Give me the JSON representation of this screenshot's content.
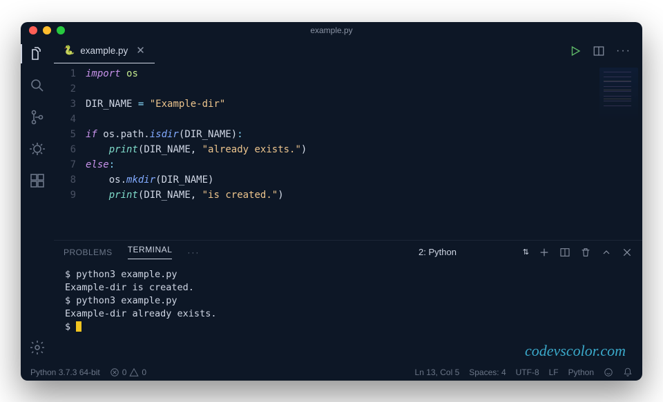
{
  "window": {
    "title": "example.py"
  },
  "tab": {
    "filename": "example.py",
    "lang_icon": "🐍"
  },
  "code": {
    "lines": [
      {
        "n": 1,
        "html": "<span class='tok-kw'>import</span> <span class='tok-mod'>os</span>"
      },
      {
        "n": 2,
        "html": ""
      },
      {
        "n": 3,
        "html": "<span class='tok-const'>DIR_NAME</span> <span class='tok-op'>=</span> <span class='tok-str'>\"Example-dir\"</span>"
      },
      {
        "n": 4,
        "html": ""
      },
      {
        "n": 5,
        "html": "<span class='tok-kw'>if</span> os.path.<span class='tok-fn'>isdir</span><span class='tok-punc'>(</span>DIR_NAME<span class='tok-punc'>)</span><span class='tok-op'>:</span>"
      },
      {
        "n": 6,
        "html": "    <span class='tok-builtin'>print</span><span class='tok-punc'>(</span>DIR_NAME<span class='tok-punc'>,</span> <span class='tok-str'>\"already exists.\"</span><span class='tok-punc'>)</span>"
      },
      {
        "n": 7,
        "html": "<span class='tok-kw'>else</span><span class='tok-op'>:</span>"
      },
      {
        "n": 8,
        "html": "    os.<span class='tok-fn'>mkdir</span><span class='tok-punc'>(</span>DIR_NAME<span class='tok-punc'>)</span>"
      },
      {
        "n": 9,
        "html": "    <span class='tok-builtin'>print</span><span class='tok-punc'>(</span>DIR_NAME<span class='tok-punc'>,</span> <span class='tok-str'>\"is created.\"</span><span class='tok-punc'>)</span>"
      }
    ]
  },
  "panel": {
    "tabs": {
      "problems": "PROBLEMS",
      "terminal": "TERMINAL"
    },
    "selector": "2: Python",
    "output": "$ python3 example.py\nExample-dir is created.\n$ python3 example.py\nExample-dir already exists.\n$ "
  },
  "status": {
    "interpreter": "Python 3.7.3 64-bit",
    "errors": "0",
    "warnings": "0",
    "cursor": "Ln 13, Col 5",
    "spaces": "Spaces: 4",
    "encoding": "UTF-8",
    "eol": "LF",
    "language": "Python"
  },
  "watermark": "codevscolor.com"
}
